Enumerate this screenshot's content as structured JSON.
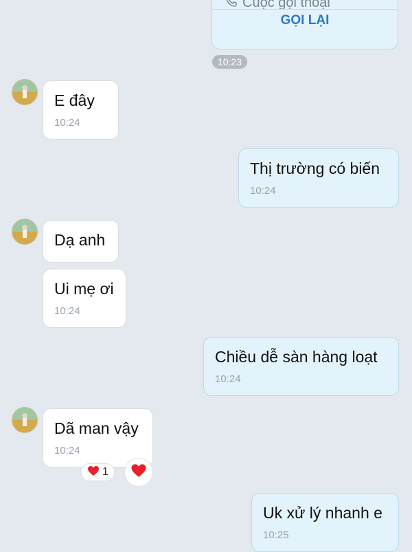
{
  "call": {
    "title": "Cuộc gọi thoại",
    "button": "GỌI LẠI"
  },
  "separator_time": "10:23",
  "messages": [
    {
      "text": "E đây",
      "time": "10:24",
      "side": "in"
    },
    {
      "text": "Thị trường có biến",
      "time": "10:24",
      "side": "out"
    },
    {
      "text": "Dạ anh",
      "time": "",
      "side": "in"
    },
    {
      "text": "Ui mẹ ơi",
      "time": "10:24",
      "side": "in"
    },
    {
      "text": "Chiều dễ sàn hàng loạt",
      "time": "10:24",
      "side": "out"
    },
    {
      "text": "Dã man vậy",
      "time": "10:24",
      "side": "in"
    },
    {
      "text": "Uk xử lý nhanh e",
      "time": "10:25",
      "side": "out"
    }
  ],
  "reaction": {
    "count": "1",
    "icon": "heart-icon",
    "color": "#e8202a"
  },
  "colors": {
    "background": "#e4e8ef",
    "outgoing_bubble": "#e3f3fc",
    "incoming_bubble": "#ffffff",
    "accent": "#2f78c8"
  }
}
